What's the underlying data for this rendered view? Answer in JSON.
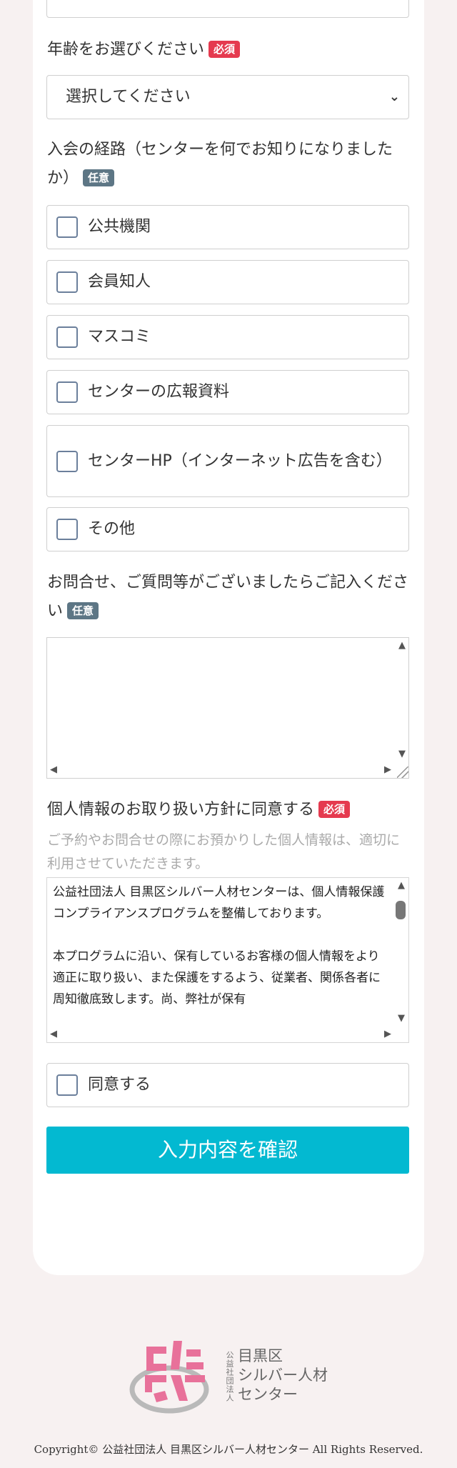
{
  "age": {
    "label": "年齢をお選びください",
    "badge": "必須",
    "select_value": "選択してください"
  },
  "route": {
    "label": "入会の経路（センターを何でお知りになりましたか）",
    "badge": "任意",
    "options": [
      "公共機関",
      "会員知人",
      "マスコミ",
      "センターの広報資料",
      "センターHP（インターネット広告を含む）",
      "その他"
    ]
  },
  "inquiry": {
    "label": "お問合せ、ご質問等がございましたらご記入ください",
    "badge": "任意",
    "value": ""
  },
  "privacy": {
    "label": "個人情報のお取り扱い方針に同意する",
    "badge": "必須",
    "note": "ご予約やお問合せの際にお預かりした個人情報は、適切に利用させていただきます。",
    "policy_paragraphs": [
      "公益社団法人 目黒区シルバー人材センターは、個人情報保護コンプライアンスプログラムを整備しております。",
      "本プログラムに沿い、保有しているお客様の個人情報をより適正に取り扱い、また保護をするよう、従業者、関係各者に周知徹底致します。尚、弊社が保有"
    ],
    "agree_label": "同意する"
  },
  "submit_label": "入力内容を確認",
  "footer": {
    "org_type": "公益社団法人",
    "org_name_lines": [
      "目黒区",
      "シルバー人材",
      "センター"
    ],
    "copyright": "Copyright© 公益社団法人 目黒区シルバー人材センター All Rights Reserved."
  },
  "colors": {
    "required_badge": "#e53a4f",
    "optional_badge": "#5d7685",
    "submit_button": "#03b9d1",
    "logo_pink": "#e8719a",
    "logo_gray": "#b9b9b9"
  }
}
